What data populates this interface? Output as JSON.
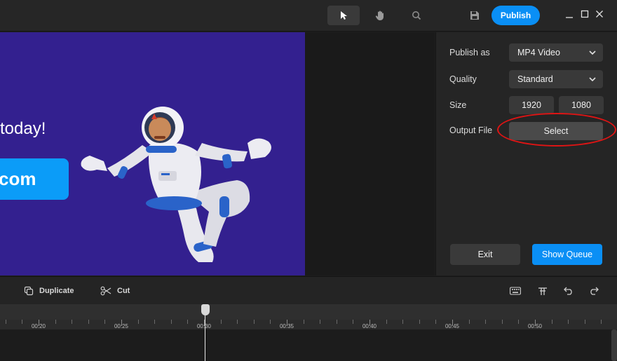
{
  "topbar": {
    "tools": [
      "select-tool",
      "hand-tool",
      "zoom-tool"
    ],
    "publish_label": "Publish"
  },
  "preview": {
    "slide_text": "today!",
    "cta_text": "com",
    "bg_color": "#33208f",
    "cta_color": "#0b9cf8"
  },
  "panel": {
    "publish_as_label": "Publish as",
    "publish_as_value": "MP4 Video",
    "quality_label": "Quality",
    "quality_value": "Standard",
    "size_label": "Size",
    "width": "1920",
    "height": "1080",
    "output_label": "Output File",
    "select_label": "Select",
    "exit_label": "Exit",
    "show_queue_label": "Show Queue"
  },
  "timeline": {
    "duplicate_label": "Duplicate",
    "cut_label": "Cut",
    "ticks": [
      "00:20",
      "00:25",
      "00:30",
      "00:35",
      "00:40",
      "00:45",
      "00:50"
    ]
  },
  "colors": {
    "accent": "#0a8ff5",
    "highlight": "#e01414"
  }
}
